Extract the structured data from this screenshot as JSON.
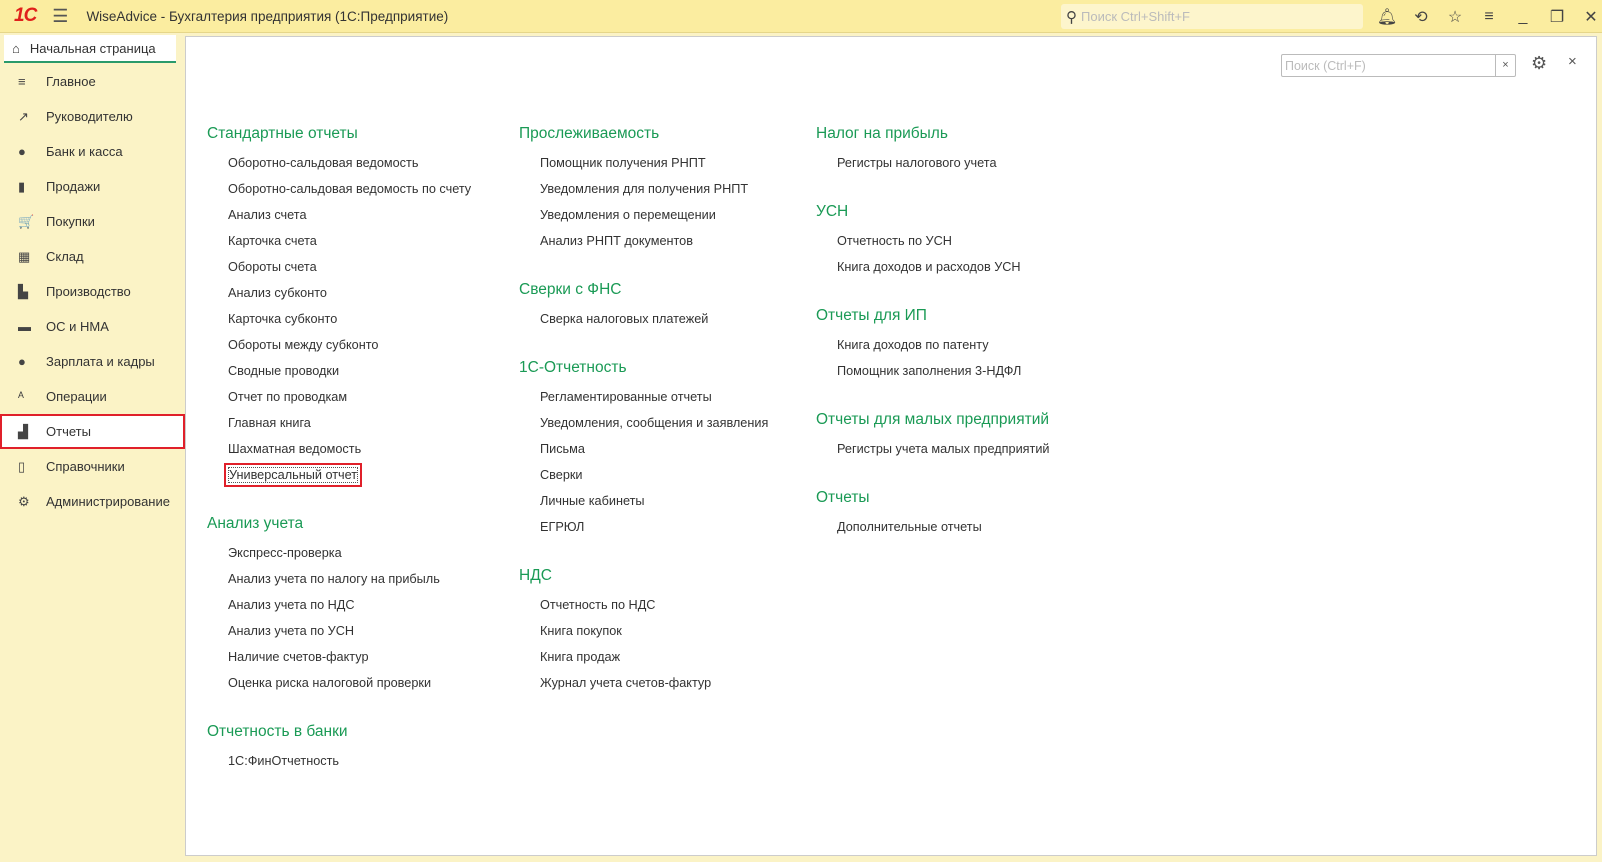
{
  "app": {
    "logo": "1С",
    "title": "WiseAdvice - Бухгалтерия предприятия  (1С:Предприятие)",
    "search_placeholder": "Поиск Ctrl+Shift+F"
  },
  "tab": {
    "label": "Начальная страница"
  },
  "sidebar": {
    "items": [
      {
        "label": "Главное",
        "icon": "≡"
      },
      {
        "label": "Руководителю",
        "icon": "↗"
      },
      {
        "label": "Банк и касса",
        "icon": "●"
      },
      {
        "label": "Продажи",
        "icon": "▮"
      },
      {
        "label": "Покупки",
        "icon": "🛒"
      },
      {
        "label": "Склад",
        "icon": "▦"
      },
      {
        "label": "Производство",
        "icon": "▙"
      },
      {
        "label": "ОС и НМА",
        "icon": "▬"
      },
      {
        "label": "Зарплата и кадры",
        "icon": "●"
      },
      {
        "label": "Операции",
        "icon": "ᴬ"
      },
      {
        "label": "Отчеты",
        "icon": "▟",
        "selected": true
      },
      {
        "label": "Справочники",
        "icon": "▯"
      },
      {
        "label": "Администрирование",
        "icon": "⚙"
      }
    ]
  },
  "panel": {
    "search_placeholder": "Поиск (Ctrl+F)",
    "clear": "×",
    "close": "×"
  },
  "columns": [
    [
      {
        "heading": "Стандартные отчеты",
        "items": [
          "Оборотно-сальдовая ведомость",
          "Оборотно-сальдовая ведомость по счету",
          "Анализ счета",
          "Карточка счета",
          "Обороты счета",
          "Анализ субконто",
          "Карточка субконто",
          "Обороты между субконто",
          "Сводные проводки",
          "Отчет по проводкам",
          "Главная книга",
          "Шахматная ведомость",
          "Универсальный отчет"
        ]
      },
      {
        "heading": "Анализ учета",
        "items": [
          "Экспресс-проверка",
          "Анализ учета по налогу на прибыль",
          "Анализ учета по НДС",
          "Анализ учета по УСН",
          "Наличие счетов-фактур",
          "Оценка риска налоговой проверки"
        ]
      },
      {
        "heading": "Отчетность в банки",
        "items": [
          "1С:ФинОтчетность"
        ]
      }
    ],
    [
      {
        "heading": "Прослеживаемость",
        "items": [
          "Помощник получения РНПТ",
          "Уведомления для получения РНПТ",
          "Уведомления о перемещении",
          "Анализ РНПТ документов"
        ]
      },
      {
        "heading": "Сверки с ФНС",
        "items": [
          "Сверка налоговых платежей"
        ]
      },
      {
        "heading": "1С-Отчетность",
        "items": [
          "Регламентированные отчеты",
          "Уведомления, сообщения и заявления",
          "Письма",
          "Сверки",
          "Личные кабинеты",
          "ЕГРЮЛ"
        ]
      },
      {
        "heading": "НДС",
        "items": [
          "Отчетность по НДС",
          "Книга покупок",
          "Книга продаж",
          "Журнал учета счетов-фактур"
        ]
      }
    ],
    [
      {
        "heading": "Налог на прибыль",
        "items": [
          "Регистры налогового учета"
        ]
      },
      {
        "heading": "УСН",
        "items": [
          "Отчетность по УСН",
          "Книга доходов и расходов УСН"
        ]
      },
      {
        "heading": "Отчеты для ИП",
        "items": [
          "Книга доходов по патенту",
          "Помощник заполнения 3-НДФЛ"
        ]
      },
      {
        "heading": "Отчеты для малых предприятий",
        "items": [
          "Регистры учета малых предприятий"
        ]
      },
      {
        "heading": "Отчеты",
        "items": [
          "Дополнительные отчеты"
        ]
      }
    ]
  ],
  "highlighted_item": "Универсальный отчет"
}
